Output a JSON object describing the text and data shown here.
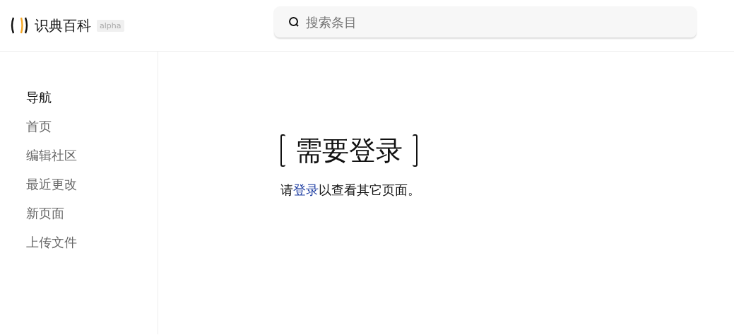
{
  "header": {
    "logo_text": "识典百科",
    "badge": "alpha",
    "search": {
      "placeholder": "搜索条目"
    }
  },
  "sidebar": {
    "heading": "导航",
    "items": [
      {
        "label": "首页"
      },
      {
        "label": "编辑社区"
      },
      {
        "label": "最近更改"
      },
      {
        "label": "新页面"
      },
      {
        "label": "上传文件"
      }
    ]
  },
  "content": {
    "title": "需要登录",
    "message": {
      "before": "请",
      "link": "登录",
      "after": "以查看其它页面。"
    }
  }
}
